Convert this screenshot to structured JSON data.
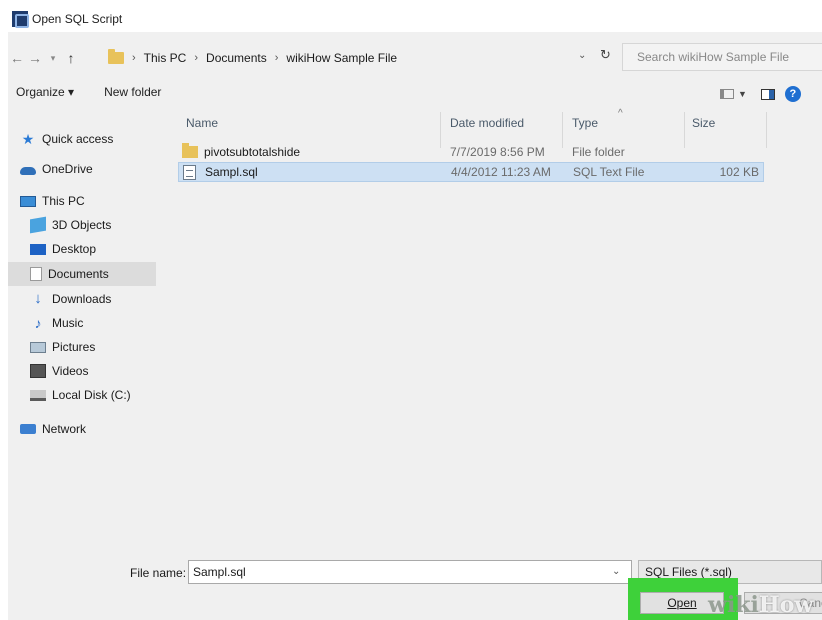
{
  "window": {
    "title": "Open SQL Script"
  },
  "address": {
    "breadcrumbs": [
      "This PC",
      "Documents",
      "wikiHow Sample File"
    ],
    "search_placeholder": "Search wikiHow Sample File"
  },
  "toolbar": {
    "organize_label": "Organize ▾",
    "new_folder_label": "New folder"
  },
  "nav": {
    "quick_access": "Quick access",
    "onedrive": "OneDrive",
    "this_pc": "This PC",
    "objects3d": "3D Objects",
    "desktop": "Desktop",
    "documents": "Documents",
    "downloads": "Downloads",
    "music": "Music",
    "pictures": "Pictures",
    "videos": "Videos",
    "local_disk": "Local Disk (C:)",
    "network": "Network"
  },
  "columns": {
    "name": "Name",
    "date": "Date modified",
    "type": "Type",
    "size": "Size"
  },
  "files": [
    {
      "name": "pivotsubtotalshide",
      "date": "7/7/2019 8:56 PM",
      "type": "File folder",
      "size": ""
    },
    {
      "name": "Sampl.sql",
      "date": "4/4/2012 11:23 AM",
      "type": "SQL Text File",
      "size": "102 KB"
    }
  ],
  "bottom": {
    "file_name_label": "File name:",
    "file_name_value": "Sampl.sql",
    "filter_value": "SQL Files (*.sql)",
    "open_label": "Open",
    "cancel_label": "Cancel"
  },
  "watermark": {
    "wiki": "wiki",
    "how": "How"
  },
  "colors": {
    "selection": "#cde0f3",
    "highlight": "#3ed13a",
    "folder": "#e8c25a"
  }
}
